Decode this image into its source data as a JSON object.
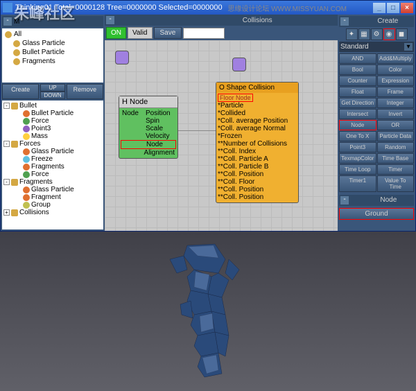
{
  "window": {
    "title": "Thinking01  Total=0000128  Tree=0000000  Selected=0000000"
  },
  "watermark": "朱峰社区",
  "watermark2": "思缘设计论坛",
  "watermark3": "WWW.MISSYUAN.COM",
  "left": {
    "tree1_header": "M",
    "tree1": [
      "All",
      "Glass Particle",
      "Bullet Particle",
      "Fragments"
    ],
    "buttons": {
      "create": "Create",
      "up": "UP",
      "down": "DOWN",
      "remove": "Remove"
    },
    "tree2": [
      {
        "label": "Bullet",
        "icon": "box",
        "exp": "-",
        "children": [
          {
            "label": "Bullet Particle",
            "icon": "b"
          },
          {
            "label": "Force",
            "icon": "f"
          },
          {
            "label": "Point3",
            "icon": "p"
          },
          {
            "label": "Mass",
            "icon": "m"
          }
        ]
      },
      {
        "label": "Forces",
        "icon": "box",
        "exp": "-",
        "children": [
          {
            "label": "Glass Particle",
            "icon": "b"
          },
          {
            "label": "Freeze",
            "icon": "fz"
          },
          {
            "label": "Fragments",
            "icon": "b"
          },
          {
            "label": "Force",
            "icon": "f"
          }
        ]
      },
      {
        "label": "Fragments",
        "icon": "box",
        "exp": "-",
        "children": [
          {
            "label": "Glass Particle",
            "icon": "b"
          },
          {
            "label": "Fragment",
            "icon": "b"
          },
          {
            "label": "Group",
            "icon": "g"
          }
        ]
      },
      {
        "label": "Collisions",
        "icon": "box",
        "exp": "+"
      }
    ]
  },
  "mid": {
    "title": "Collisions",
    "toolbar": {
      "on": "ON",
      "valid": "Valid",
      "save": "Save"
    },
    "hnode": {
      "title": "H Node",
      "left": [
        "Node",
        "",
        "",
        "",
        ""
      ],
      "right": [
        "Position",
        "Spin",
        "Scale",
        "Velocity",
        "Node",
        "Alignment"
      ]
    },
    "onode": {
      "title": "O Shape Collision",
      "floor": "Floor Node",
      "rows": [
        "*Particle",
        "*Collided",
        "*Coll. average Position",
        "*Coll. average Normal",
        "*Frozen",
        "**Number of Collisions",
        "**Coll. Index",
        "**Coll. Particle A",
        "**Coll. Particle B",
        "**Coll. Position",
        "**Coll. Floor",
        "**Coll. Position",
        "**Coll. Position"
      ]
    }
  },
  "right": {
    "title": "Create",
    "dropdown": "Standard",
    "grid": [
      [
        "AND",
        "Add&Multiply"
      ],
      [
        "Bool",
        "Color"
      ],
      [
        "Counter",
        "Expression"
      ],
      [
        "Float",
        "Frame"
      ],
      [
        "Get Direction",
        "Integer"
      ],
      [
        "Intersect",
        "Invert"
      ],
      [
        "Node",
        "OR"
      ],
      [
        "One To X",
        "Particle Data"
      ],
      [
        "Point3",
        "Random"
      ],
      [
        "TexmapColor",
        "Time Base"
      ],
      [
        "Time Loop",
        "Timer"
      ],
      [
        "Timer1",
        "Value To Time"
      ]
    ],
    "section": "Node",
    "ground": "Ground"
  }
}
